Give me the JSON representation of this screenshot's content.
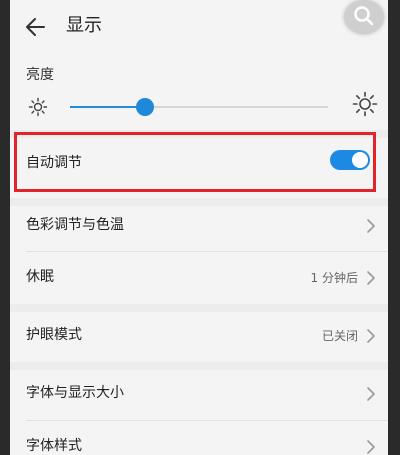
{
  "header": {
    "title": "显示",
    "back_icon": "arrow-left-icon",
    "search_icon": "search-icon"
  },
  "brightness": {
    "label": "亮度",
    "level_fraction": 0.29,
    "low_icon": "sun-small-icon",
    "high_icon": "sun-large-icon",
    "accent_color": "#1f88d8"
  },
  "auto_adjust": {
    "label": "自动调节",
    "enabled": true,
    "highlight_color": "#e0242a"
  },
  "settings": {
    "color_temp": {
      "label": "色彩调节与色温"
    },
    "sleep": {
      "label": "休眠",
      "value": "1 分钟后"
    },
    "eye_care": {
      "label": "护眼模式",
      "value": "已关闭"
    },
    "font_size": {
      "label": "字体与显示大小"
    },
    "font_style": {
      "label": "字体样式"
    }
  }
}
